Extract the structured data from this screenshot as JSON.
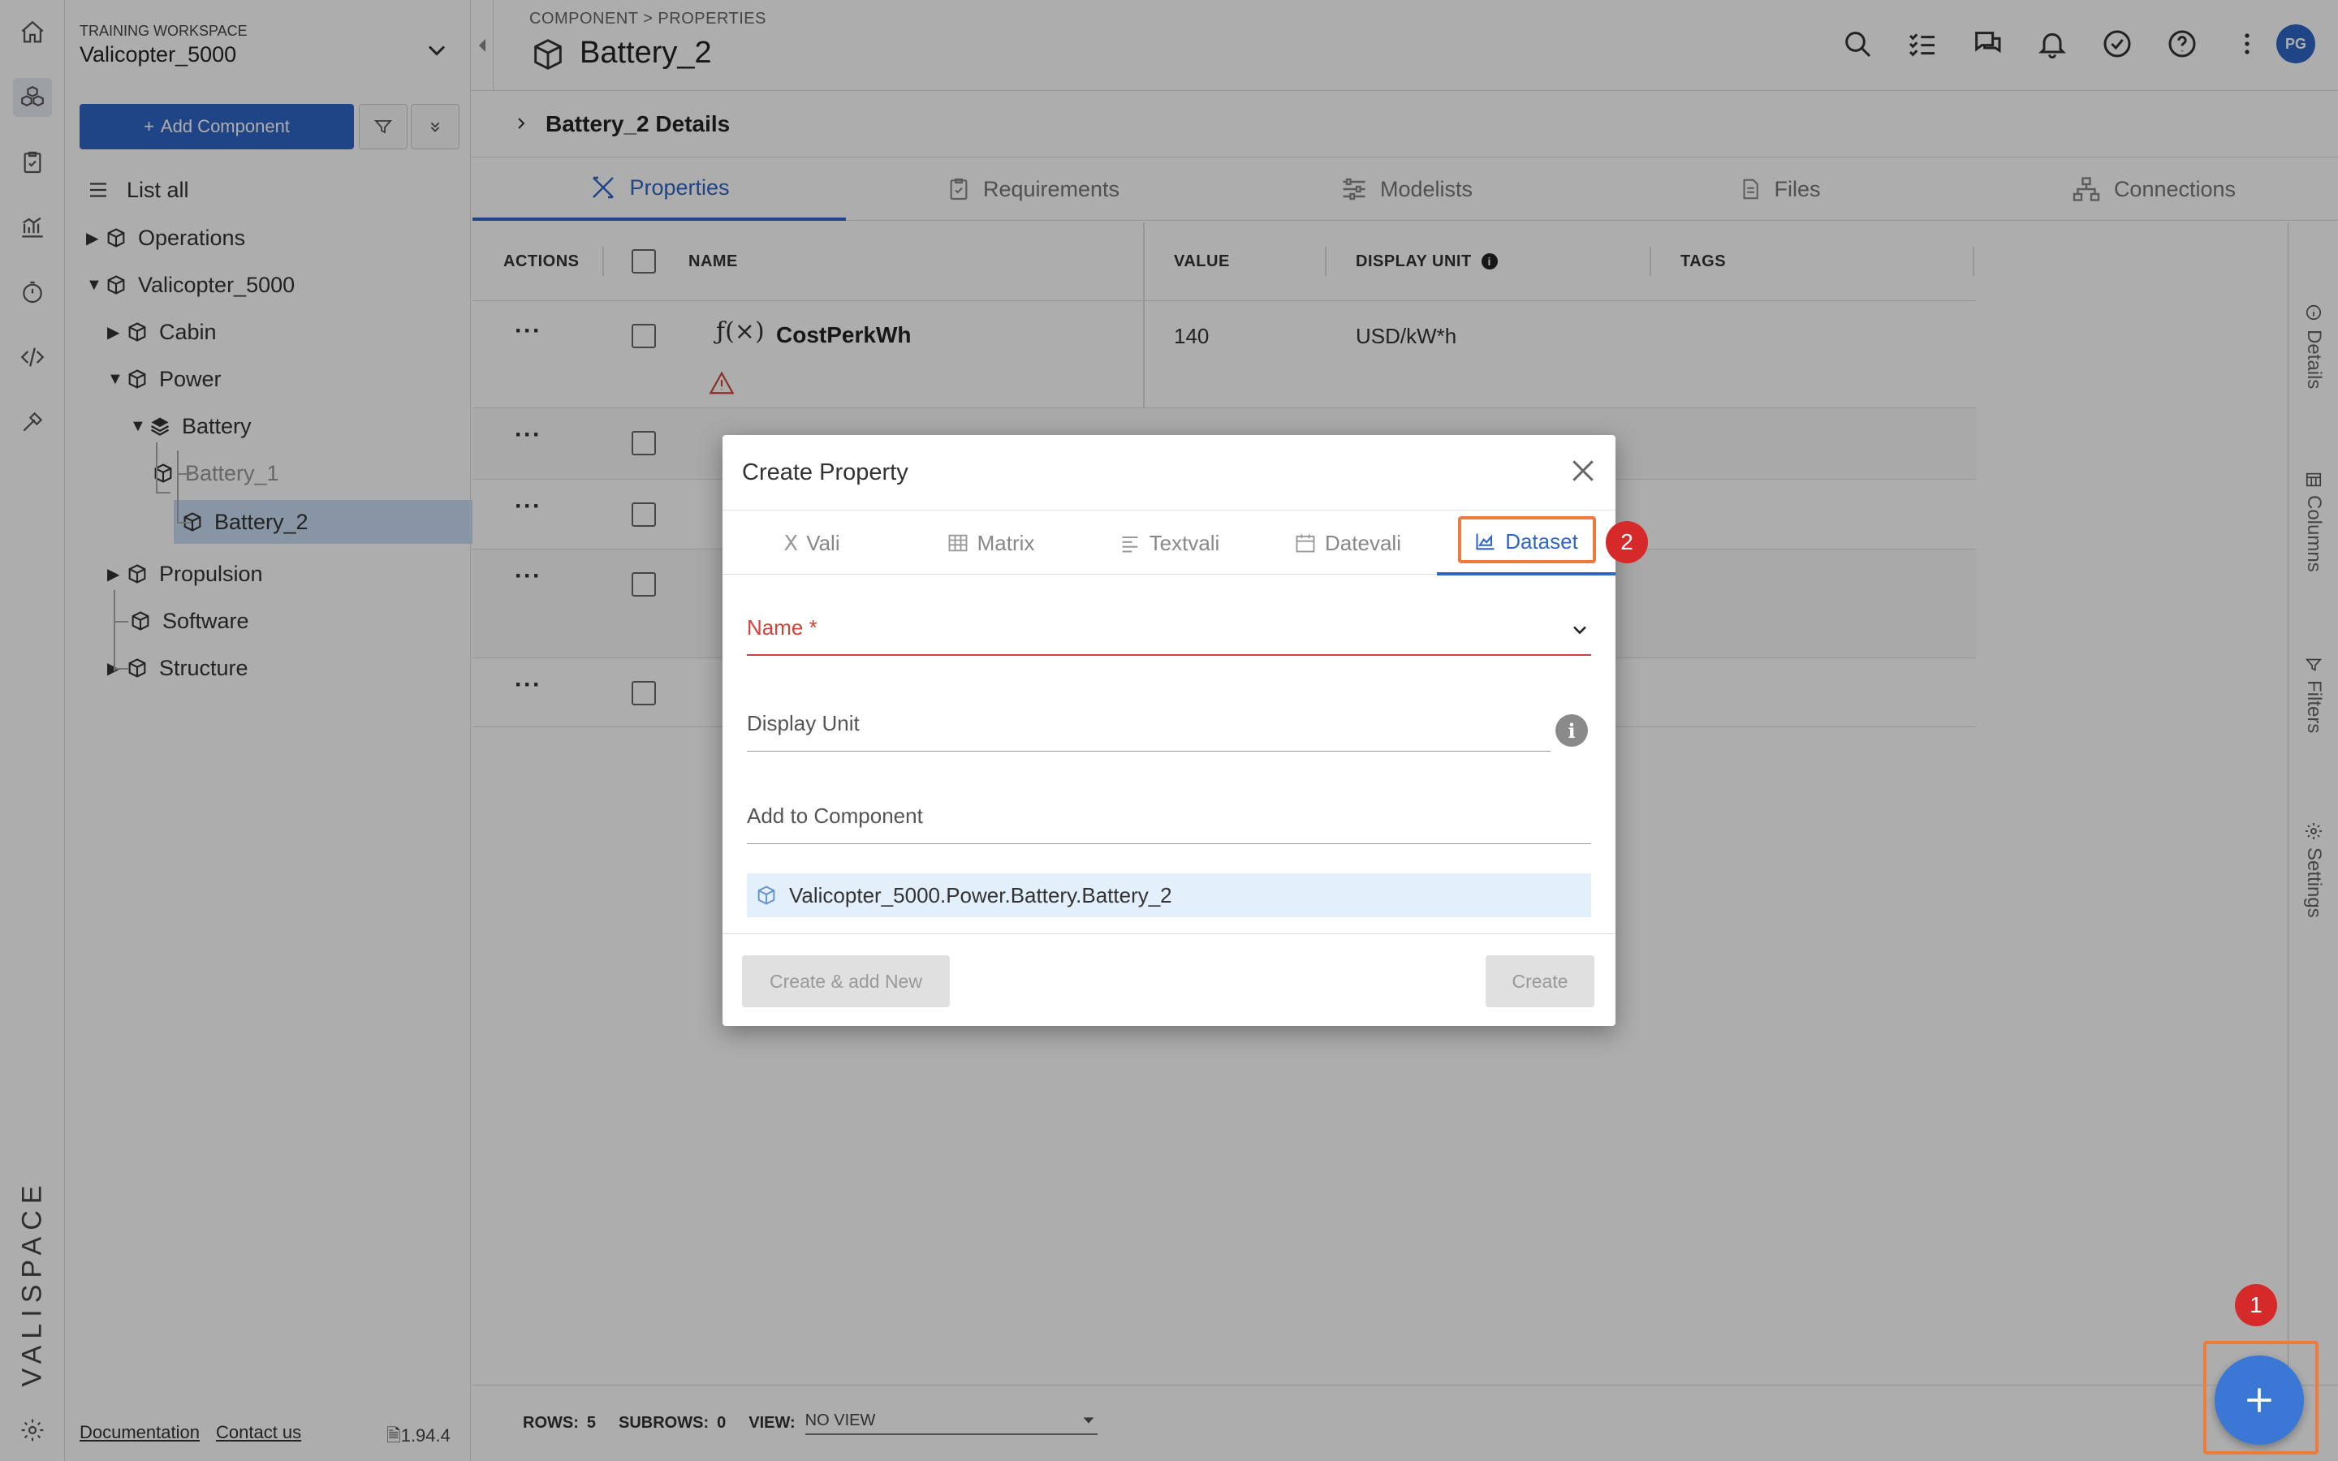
{
  "workspace": {
    "label": "TRAINING WORKSPACE",
    "name": "Valicopter_5000"
  },
  "sidebar": {
    "add_component": "Add Component",
    "list_all": "List all",
    "tree": [
      {
        "label": "Operations",
        "level": 0,
        "expanded": false,
        "icon": "cube-icon"
      },
      {
        "label": "Valicopter_5000",
        "level": 0,
        "expanded": true,
        "icon": "cube-icon"
      },
      {
        "label": "Cabin",
        "level": 1,
        "expanded": false,
        "icon": "cube-icon"
      },
      {
        "label": "Power",
        "level": 1,
        "expanded": true,
        "icon": "cube-icon"
      },
      {
        "label": "Battery",
        "level": 2,
        "expanded": true,
        "icon": "layers-icon"
      },
      {
        "label": "Battery_1",
        "level": 3,
        "icon": "cube-icon"
      },
      {
        "label": "Battery_2",
        "level": 3,
        "icon": "cube-icon",
        "selected": true
      },
      {
        "label": "Propulsion",
        "level": 1,
        "expanded": false,
        "icon": "cube-icon"
      },
      {
        "label": "Software",
        "level": 1,
        "icon": "cube-icon"
      },
      {
        "label": "Structure",
        "level": 1,
        "expanded": false,
        "icon": "cube-icon"
      }
    ],
    "footer": {
      "documentation": "Documentation",
      "contact": "Contact us",
      "version": "1.94.4"
    }
  },
  "header": {
    "breadcrumb": "COMPONENT > PROPERTIES",
    "title": "Battery_2",
    "avatar": "PG"
  },
  "details_bar": {
    "label": "Battery_2 Details"
  },
  "tabs": [
    "Properties",
    "Requirements",
    "Modelists",
    "Files",
    "Connections"
  ],
  "table": {
    "columns": {
      "actions": "ACTIONS",
      "name": "NAME",
      "value": "VALUE",
      "display_unit": "DISPLAY UNIT",
      "tags": "TAGS"
    },
    "first_row": {
      "name": "CostPerkWh",
      "value": "140",
      "unit": "USD/kW*h",
      "formula_glyph": "ƒ(×)"
    }
  },
  "right_rail": [
    "Details",
    "Columns",
    "Filters",
    "Settings"
  ],
  "footer": {
    "rows_label": "ROWS:",
    "rows": "5",
    "subrows_label": "SUBROWS:",
    "subrows": "0",
    "view_label": "VIEW:",
    "view_value": "NO VIEW"
  },
  "dialog": {
    "title": "Create Property",
    "tabs": [
      "Vali",
      "Matrix",
      "Textvali",
      "Datevali",
      "Dataset"
    ],
    "active_tab": "Dataset",
    "name_label": "Name *",
    "display_unit_label": "Display Unit",
    "add_to_component_label": "Add to Component",
    "component_path": "Valicopter_5000.Power.Battery.Battery_2",
    "create_add_new": "Create & add New",
    "create": "Create"
  },
  "badges": {
    "one": "1",
    "two": "2"
  },
  "colors": {
    "primary": "#2f66c6",
    "highlight": "#ee7a3c",
    "badge": "#d62a2a",
    "error": "#d0443a"
  }
}
